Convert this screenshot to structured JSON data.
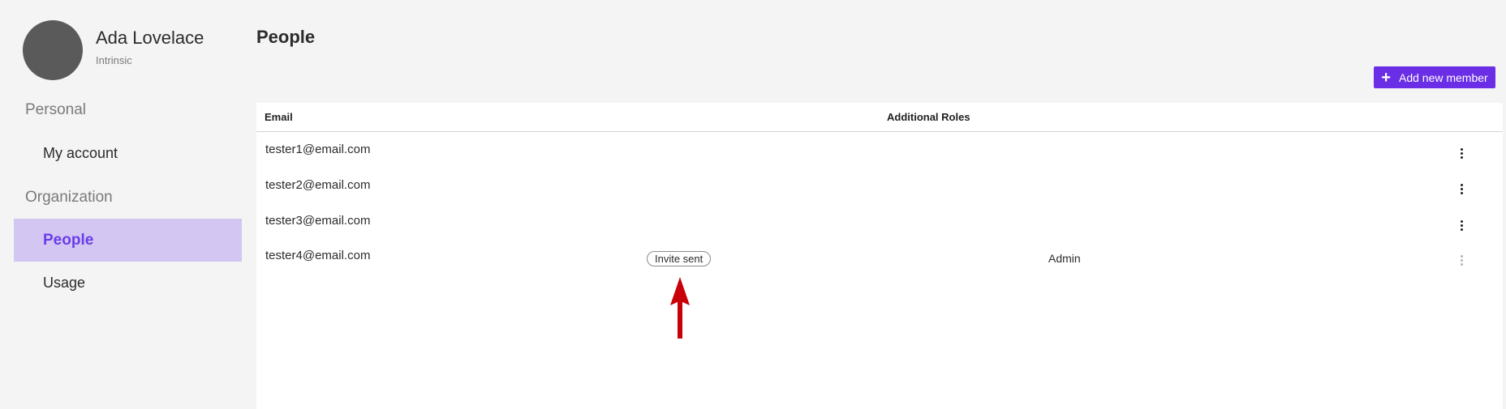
{
  "profile": {
    "name": "Ada Lovelace",
    "org": "Intrinsic"
  },
  "sidebar": {
    "sections": [
      {
        "label": "Personal",
        "items": [
          {
            "label": "My account",
            "active": false
          }
        ]
      },
      {
        "label": "Organization",
        "items": [
          {
            "label": "People",
            "active": true
          },
          {
            "label": "Usage",
            "active": false
          }
        ]
      }
    ]
  },
  "main": {
    "title": "People",
    "add_button": {
      "label": "Add new member",
      "icon": "plus-icon"
    },
    "table": {
      "columns": [
        "Email",
        "Additional Roles"
      ],
      "rows": [
        {
          "email": "tester1@email.com",
          "badge": "",
          "role": ""
        },
        {
          "email": "tester2@email.com",
          "badge": "",
          "role": ""
        },
        {
          "email": "tester3@email.com",
          "badge": "",
          "role": ""
        },
        {
          "email": "tester4@email.com",
          "badge": "Invite sent",
          "role": "Admin"
        }
      ]
    }
  },
  "colors": {
    "accent": "#6a2ee6",
    "active_nav_bg": "#d3c6f2",
    "active_nav_text": "#6a3de8",
    "annotation_arrow": "#c8000a"
  }
}
